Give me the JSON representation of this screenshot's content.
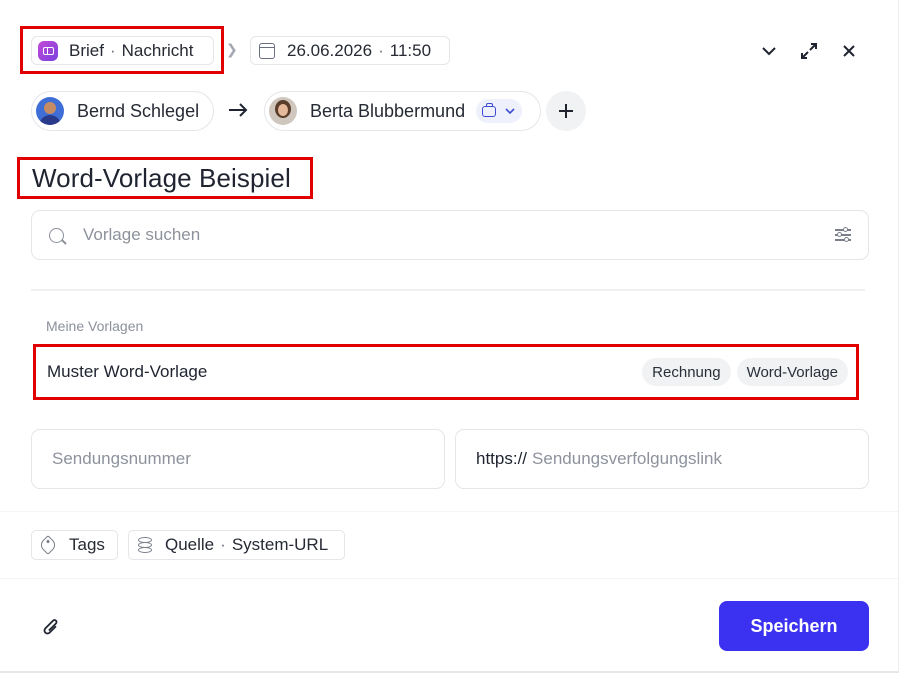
{
  "header": {
    "type_label": "Brief",
    "type_separator": "·",
    "type_sublabel": "Nachricht",
    "date": "26.06.2026",
    "time_separator": "·",
    "time": "11:50",
    "icons": [
      "chevron-down-icon",
      "expand-icon",
      "close-icon"
    ]
  },
  "participants": {
    "sender": "Bernd Schlegel",
    "recipient": "Berta Blubbermund"
  },
  "title": "Word-Vorlage Beispiel",
  "search": {
    "placeholder": "Vorlage suchen",
    "value": ""
  },
  "templates": {
    "section_label": "Meine Vorlagen",
    "items": [
      {
        "name": "Muster Word-Vorlage",
        "tags": [
          "Rechnung",
          "Word-Vorlage"
        ]
      }
    ]
  },
  "shipment": {
    "number_placeholder": "Sendungsnummer",
    "link_prefix": "https://",
    "link_placeholder": "Sendungsverfolgungslink"
  },
  "meta": {
    "tags_label": "Tags",
    "source_label": "Quelle",
    "source_separator": "·",
    "source_value": "System-URL"
  },
  "footer": {
    "save_label": "Speichern"
  },
  "colors": {
    "primary": "#3b31f0",
    "highlight_box": "#e00000",
    "type_badge": "#b04ad9"
  }
}
